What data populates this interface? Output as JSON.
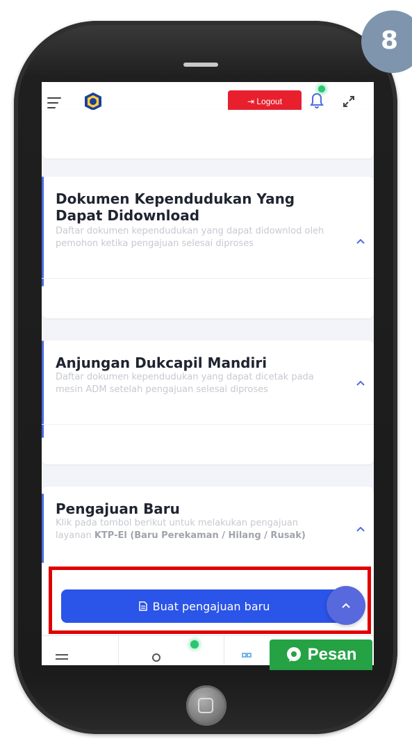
{
  "step_number": "8",
  "header": {
    "logout_label": "Logout",
    "logout_icon": "logout-arrow-icon"
  },
  "sections": [
    {
      "title": "Dokumen Kependudukan Yang Dapat Didownload",
      "description": "Daftar dokumen kependudukan yang dapat didownlod oleh pemohon ketika pengajuan selesai diproses"
    },
    {
      "title": "Anjungan Dukcapil Mandiri",
      "description": "Daftar dokumen kependudukan yang dapat dicetak pada mesin ADM setelah pengajuan selesai diproses"
    },
    {
      "title": "Pengajuan Baru",
      "description_prefix": "Klik pada tombol berikut untuk melakukan pengajuan layanan ",
      "description_bold": "KTP-El (Baru Perekaman / Hilang / Rusak)"
    }
  ],
  "create_button": {
    "label": "Buat pengajuan baru",
    "icon": "document-icon"
  },
  "chat": {
    "label": "Pesan",
    "icon": "chat-bubble-icon"
  },
  "colors": {
    "logout": "#e8202e",
    "primary": "#2b54e8",
    "highlight_border": "#e00000",
    "chat": "#25a244",
    "notification_dot": "#29c76f",
    "accent": "#4d6bde"
  }
}
